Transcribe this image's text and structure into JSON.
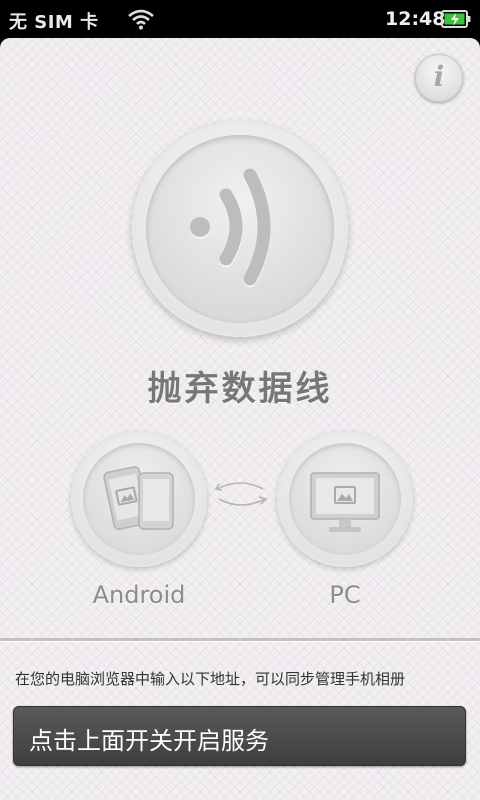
{
  "status_bar": {
    "carrier": "无 SIM 卡",
    "time": "12:48",
    "wifi_icon": "wifi-icon",
    "battery_icon": "battery-charging-icon"
  },
  "info_button": {
    "label": "i",
    "icon": "info-icon"
  },
  "power_toggle": {
    "icon": "wireless-signal-icon"
  },
  "main_title": "抛弃数据线",
  "devices": {
    "android": {
      "label": "Android",
      "icon": "phones-gallery-icon"
    },
    "pc": {
      "label": "PC",
      "icon": "monitor-gallery-icon"
    },
    "sync_icon": "sync-arrows-icon"
  },
  "instruction": "在您的电脑浏览器中输入以下地址，可以同步管理手机相册",
  "service_button": {
    "label": "点击上面开关开启服务"
  },
  "colors": {
    "accent_battery": "#3bc43b",
    "button_dark": "#4a4a4a",
    "title_gray": "#777777"
  }
}
